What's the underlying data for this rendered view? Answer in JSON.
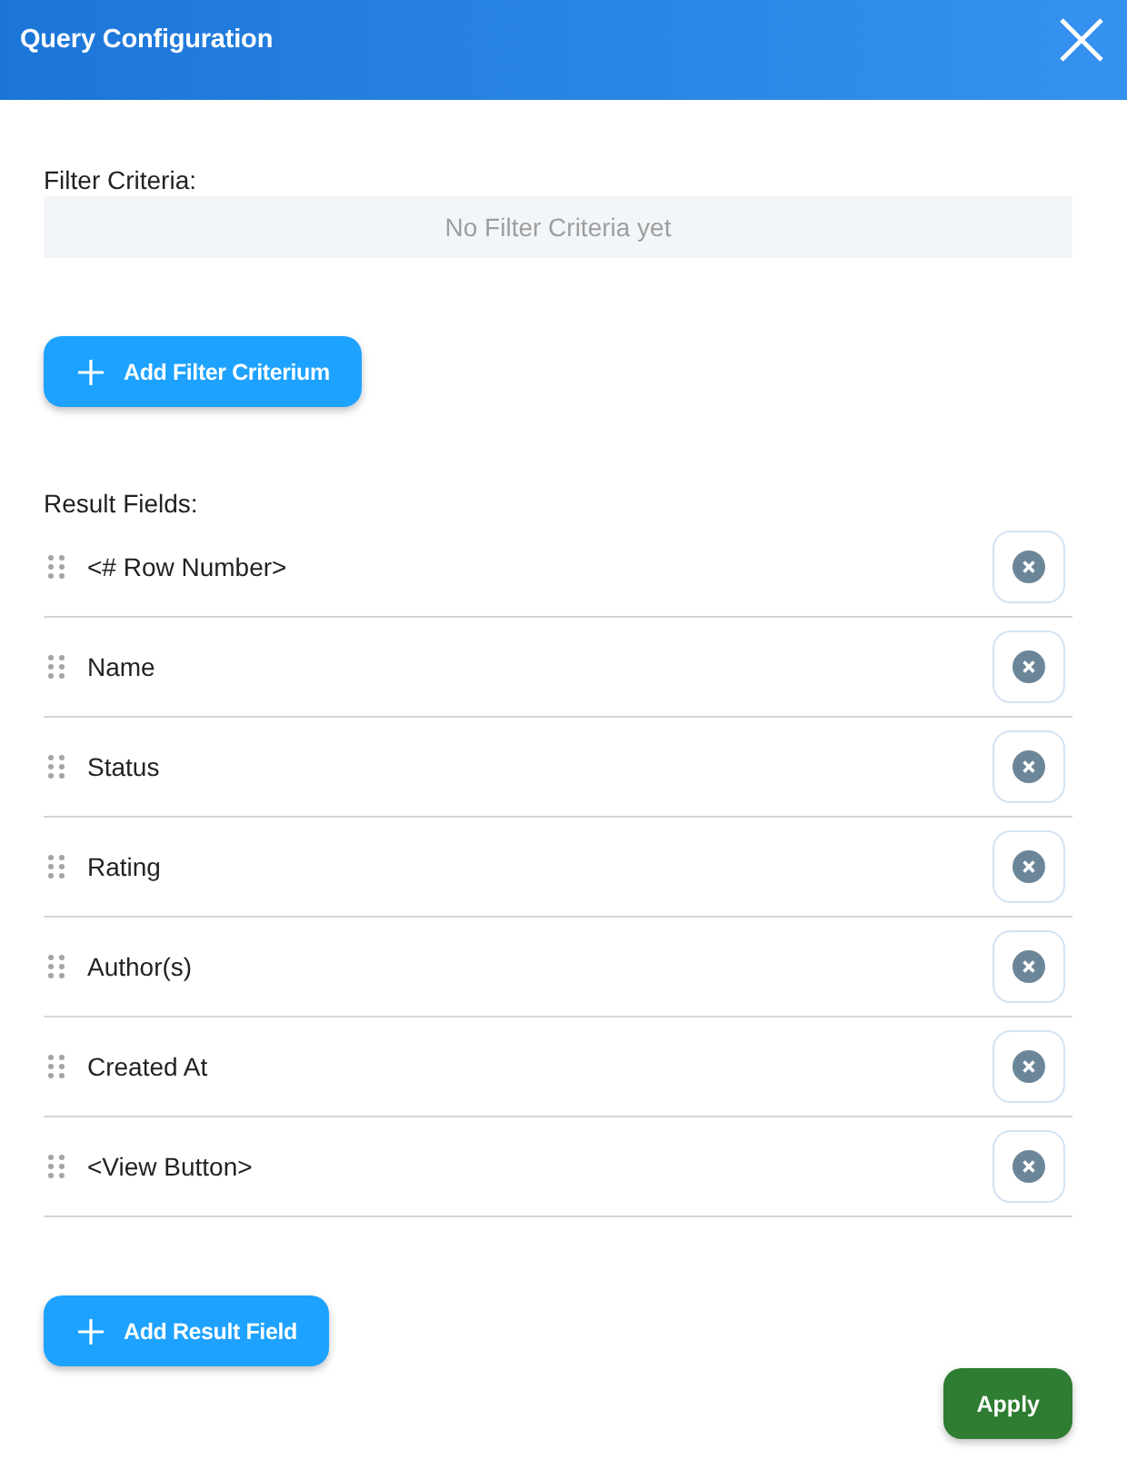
{
  "window": {
    "title": "Query Configuration"
  },
  "filter_criteria": {
    "label": "Filter Criteria:",
    "empty_message": "No Filter Criteria yet",
    "add_button": "Add Filter Criterium"
  },
  "result_fields": {
    "label": "Result Fields:",
    "items": [
      {
        "name": "<# Row Number>"
      },
      {
        "name": "Name"
      },
      {
        "name": "Status"
      },
      {
        "name": "Rating"
      },
      {
        "name": "Author(s)"
      },
      {
        "name": "Created At"
      },
      {
        "name": "<View Button>"
      }
    ],
    "add_button": "Add Result Field"
  },
  "apply_button": "Apply"
}
